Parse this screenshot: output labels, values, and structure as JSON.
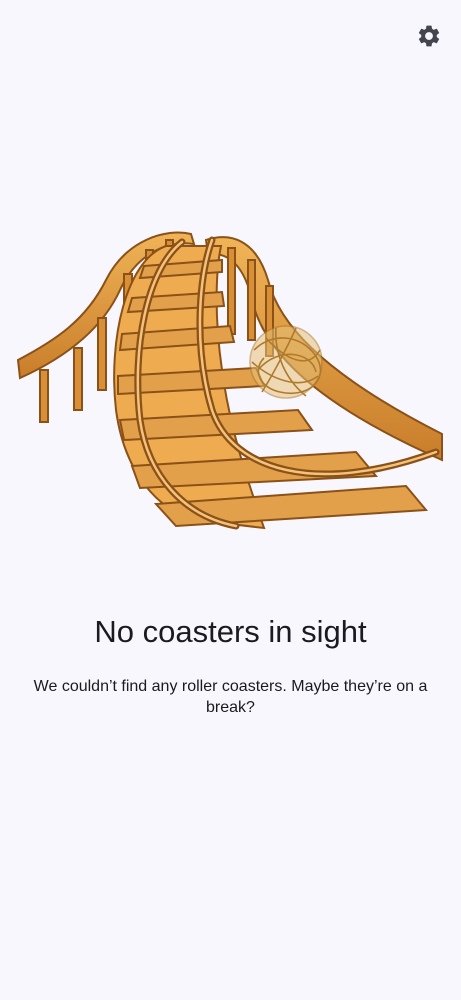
{
  "toolbar": {
    "settings_icon": "gear-icon"
  },
  "empty_state": {
    "illustration": "wooden-roller-coaster-with-tumbleweed",
    "title": "No coasters in sight",
    "message": "We couldn’t find any roller coasters. Maybe they’re on a break?"
  },
  "colors": {
    "background": "#f8f7fd",
    "text": "#1b1b1f",
    "icon": "#44464f",
    "wood_light": "#e9a94a",
    "wood_dark": "#8a5118"
  }
}
